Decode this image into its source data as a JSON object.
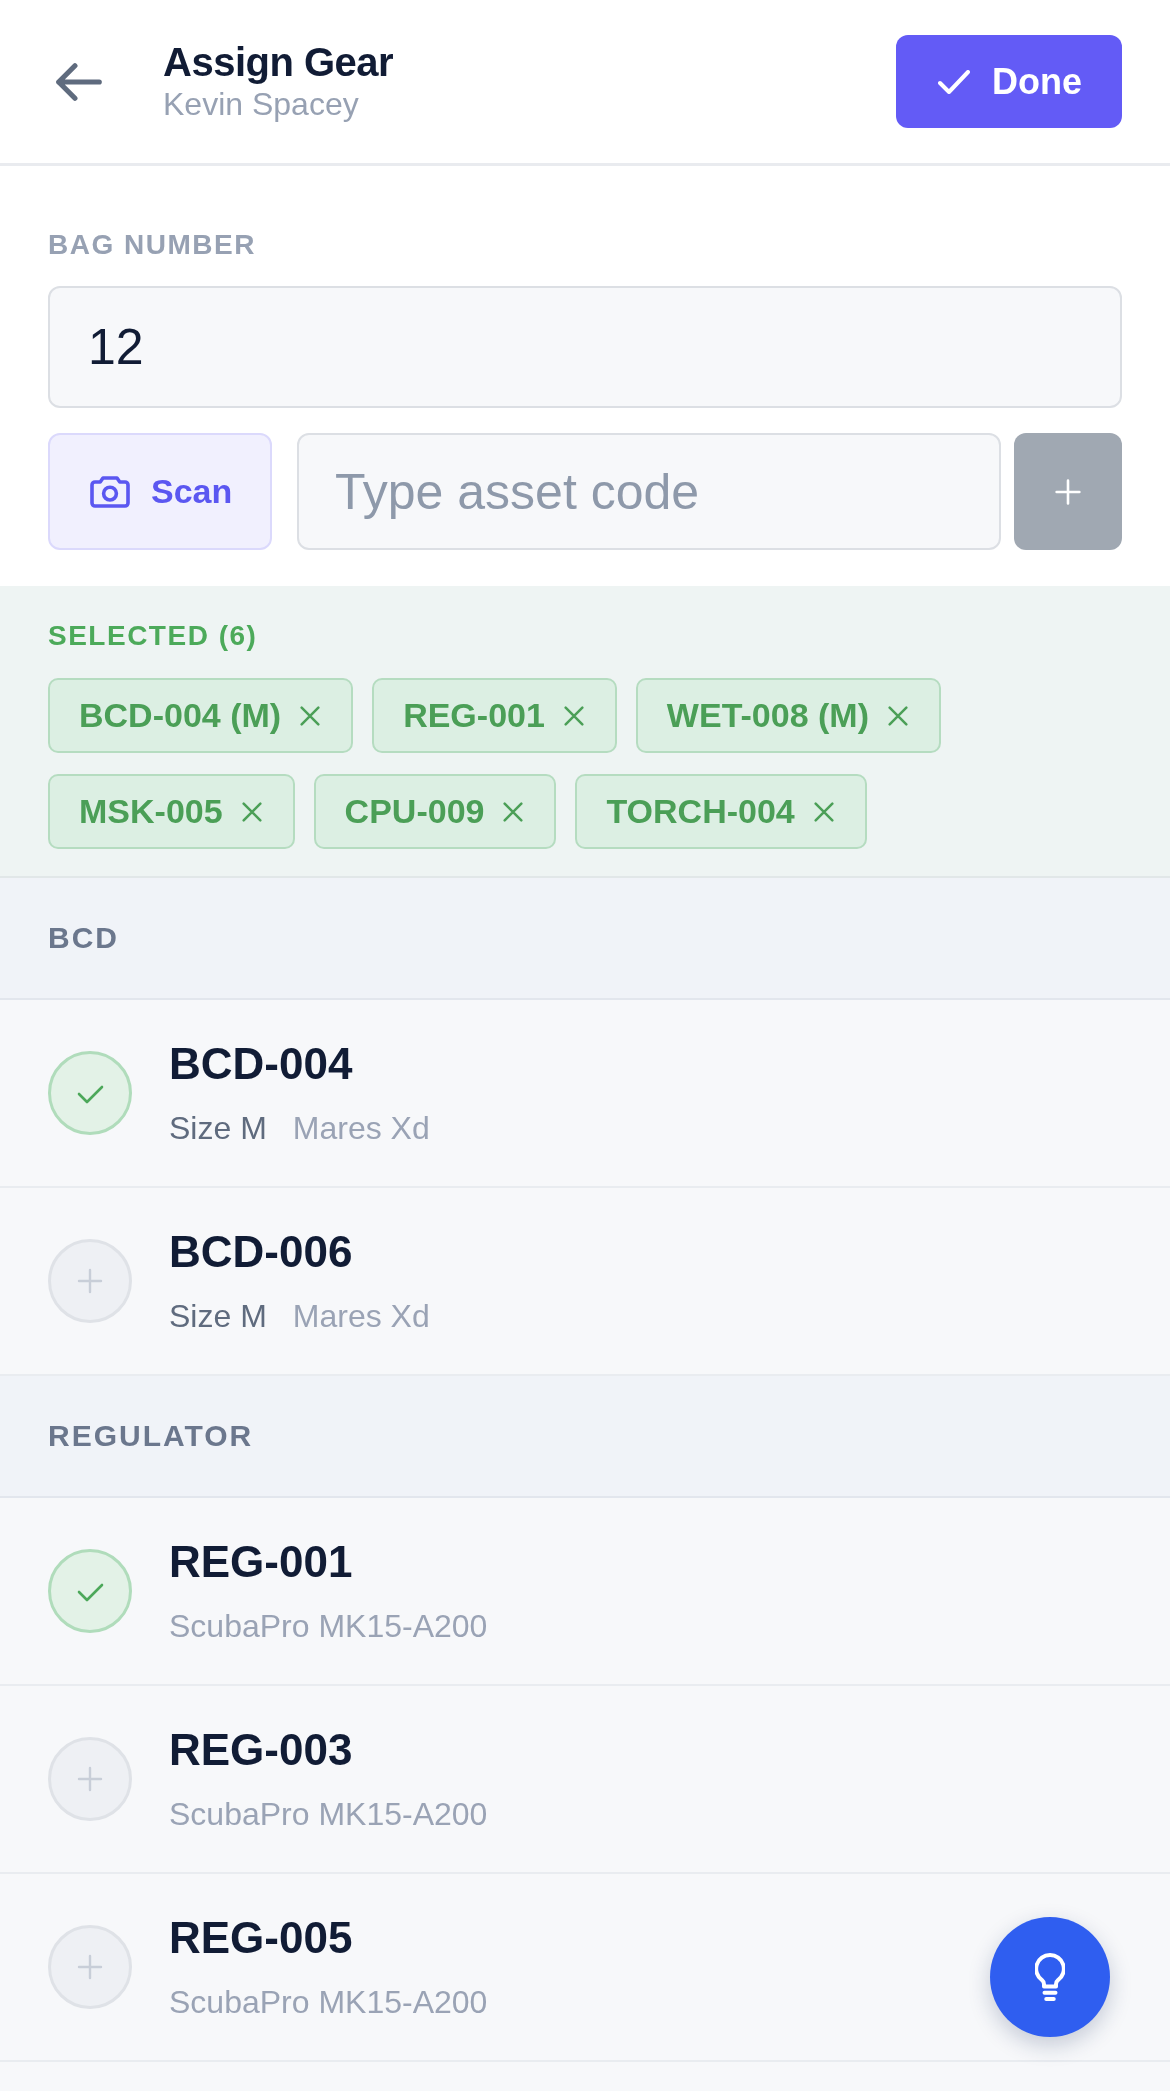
{
  "header": {
    "title": "Assign Gear",
    "subtitle": "Kevin Spacey",
    "done_label": "Done"
  },
  "bag_number": {
    "label": "BAG NUMBER",
    "value": "12"
  },
  "asset_entry": {
    "scan_label": "Scan",
    "placeholder": "Type asset code",
    "add_button": {
      "disabled": true
    }
  },
  "selected": {
    "label": "SELECTED (6)",
    "chips": [
      "BCD-004 (M)",
      "REG-001",
      "WET-008 (M)",
      "MSK-005",
      "CPU-009",
      "TORCH-004"
    ]
  },
  "categories": [
    {
      "name": "BCD",
      "items": [
        {
          "code": "BCD-004",
          "size": "Size M",
          "model": "Mares Xd",
          "selected": true
        },
        {
          "code": "BCD-006",
          "size": "Size M",
          "model": "Mares Xd",
          "selected": false
        }
      ]
    },
    {
      "name": "REGULATOR",
      "items": [
        {
          "code": "REG-001",
          "model": "ScubaPro MK15-A200",
          "selected": true
        },
        {
          "code": "REG-003",
          "model": "ScubaPro MK15-A200",
          "selected": false
        },
        {
          "code": "REG-005",
          "model": "ScubaPro MK15-A200",
          "selected": false
        }
      ]
    }
  ]
}
